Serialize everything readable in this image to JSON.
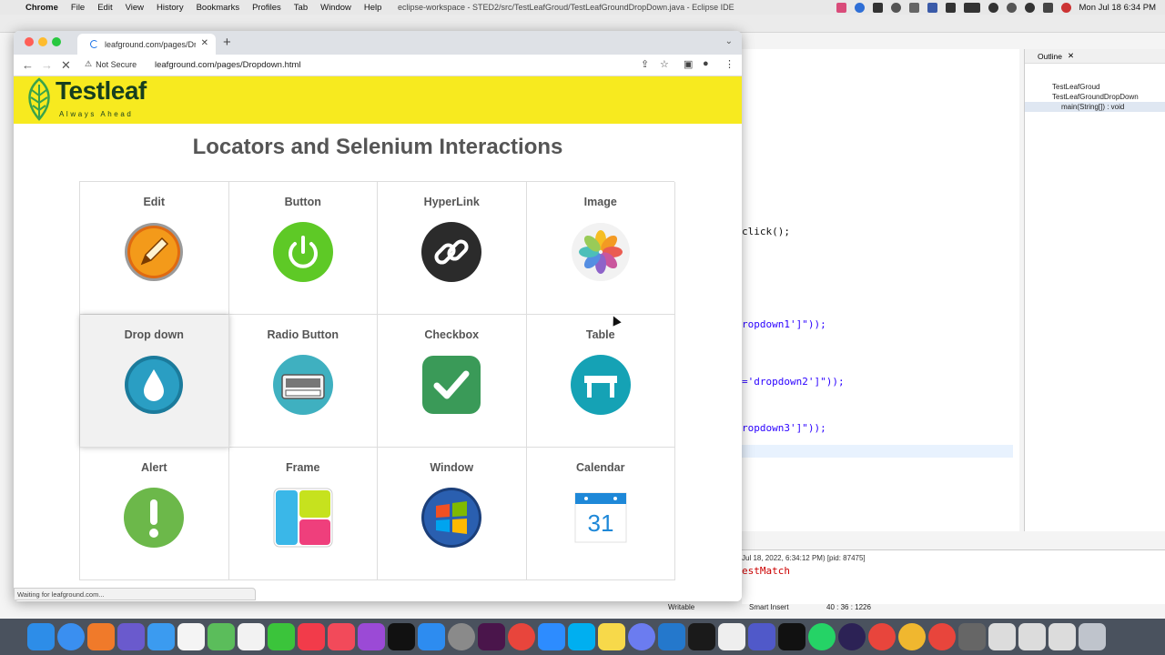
{
  "menubar": {
    "app": "Chrome",
    "items": [
      "File",
      "Edit",
      "View",
      "History",
      "Bookmarks",
      "Profiles",
      "Tab",
      "Window",
      "Help"
    ],
    "window_title": "eclipse-workspace - STED2/src/TestLeafGroud/TestLeafGroundDropDown.java - Eclipse IDE",
    "clock": "Mon Jul 18  6:34 PM"
  },
  "eclipse": {
    "code_lines": [
      {
        "text": "click();",
        "kind": "plain"
      },
      {
        "text": "ropdown1']\"));",
        "kind": "str"
      },
      {
        "text": "='dropdown2']\"));",
        "kind": "str"
      },
      {
        "text": "ropdown3']\"));",
        "kind": "str"
      }
    ],
    "outline": {
      "title": "Outline",
      "items": [
        "TestLeafGroud",
        "TestLeafGroundDropDown",
        "main(String[]) : void"
      ]
    },
    "console_log": "Jul 18, 2022, 6:34:12 PM) [pid: 87475]",
    "console_error": "estMatch",
    "status": {
      "writable": "Writable",
      "insert": "Smart Insert",
      "position": "40 : 36 : 1226"
    }
  },
  "chrome": {
    "tab_title": "leafground.com/pages/Dropdo",
    "security": "Not Secure",
    "url": "leafground.com/pages/Dropdown.html",
    "status_bubble": "Waiting for leafground.com..."
  },
  "page": {
    "brand": "Testleaf",
    "tagline": "Always Ahead",
    "title": "Locators and Selenium Interactions",
    "tiles": [
      {
        "label": "Edit",
        "icon": "edit-pencil-icon"
      },
      {
        "label": "Button",
        "icon": "power-button-icon"
      },
      {
        "label": "HyperLink",
        "icon": "link-chain-icon"
      },
      {
        "label": "Image",
        "icon": "photos-flower-icon"
      },
      {
        "label": "Drop down",
        "icon": "water-drop-icon"
      },
      {
        "label": "Radio Button",
        "icon": "radio-device-icon"
      },
      {
        "label": "Checkbox",
        "icon": "checkmark-icon"
      },
      {
        "label": "Table",
        "icon": "table-furniture-icon"
      },
      {
        "label": "Alert",
        "icon": "exclamation-icon"
      },
      {
        "label": "Frame",
        "icon": "frame-layout-icon"
      },
      {
        "label": "Window",
        "icon": "windows-logo-icon"
      },
      {
        "label": "Calendar",
        "icon": "calendar-icon"
      }
    ],
    "calendar_day": "31"
  },
  "colors": {
    "banner": "#f7ea1f",
    "brand_text": "#163e1f",
    "title_text": "#555555"
  }
}
